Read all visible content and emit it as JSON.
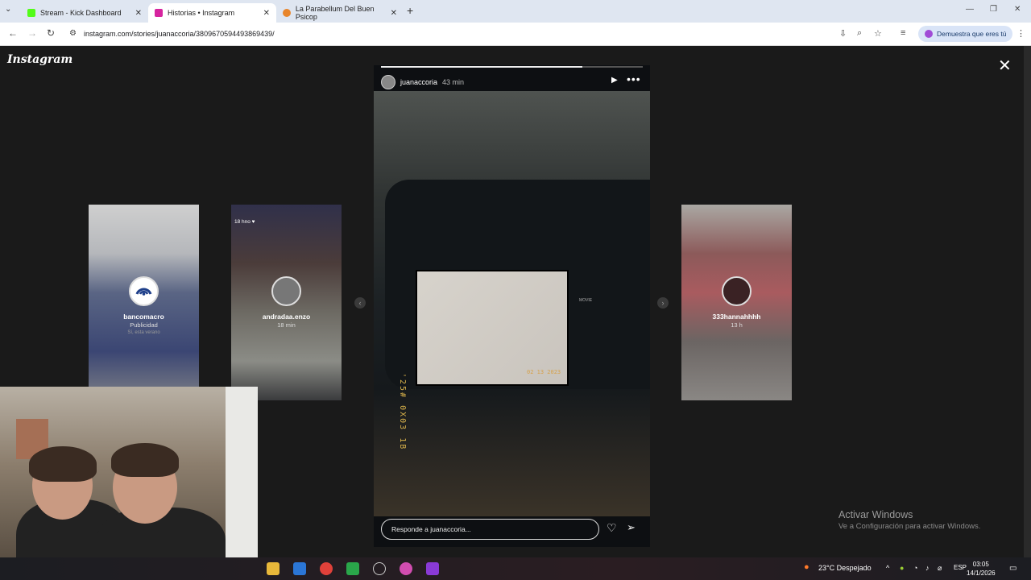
{
  "browser": {
    "tabs": [
      {
        "title": "Stream - Kick Dashboard",
        "favicon_color": "#53fc18"
      },
      {
        "title": "Historias • Instagram",
        "favicon_color": "#d6249f"
      },
      {
        "title": "La Parabellum Del Buen Psicop",
        "favicon_color": "#e8852b"
      }
    ],
    "url": "instagram.com/stories/juanaccoria/3809670594493869439/",
    "profile_label": "Demuestra que eres tú"
  },
  "instagram": {
    "logo": "Instagram",
    "close_icon": "close-icon"
  },
  "story": {
    "username": "juanaccoria",
    "time": "43 min",
    "progress": 0.77,
    "camera_date": "02 13 2023",
    "side_date": "'25# 0X03 1B",
    "camera_mode": "MOVIE",
    "reply_placeholder": "Responde a juanaccoria..."
  },
  "previews": {
    "left1": {
      "name": "bancomacro",
      "sub": "Publicidad",
      "note": "Sí, esta verano"
    },
    "left2": {
      "name": "andradaa.enzo",
      "sub": "18 min",
      "tag": "18 hno ♥"
    },
    "right1": {
      "name": "333hannahhhh",
      "sub": "13 h"
    }
  },
  "windows_watermark": {
    "line1": "Activar Windows",
    "line2": "Ve a Configuración para activar Windows."
  },
  "taskbar": {
    "weather": "23°C  Despejado",
    "lang": "ESP",
    "time": "03:05",
    "date": "14/1/2026"
  }
}
